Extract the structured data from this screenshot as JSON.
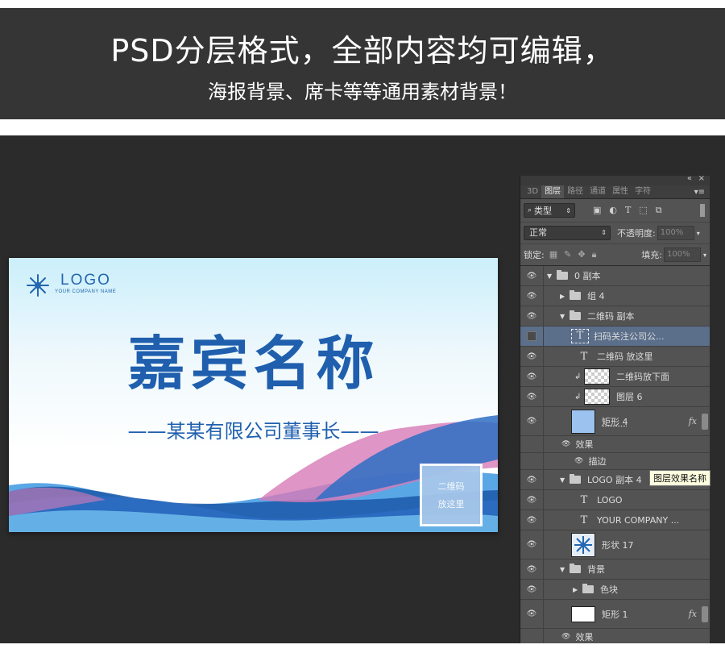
{
  "banner": {
    "headline": "PSD分层格式，全部内容均可编辑，",
    "subline": "海报背景、席卡等等通用素材背景！"
  },
  "card": {
    "logo_text": "LOGO",
    "logo_sub": "YOUR COMPANY NAME",
    "guest_name": "嘉宾名称",
    "title": "——某某有限公司董事长——",
    "qr_line1": "二维码",
    "qr_line2": "放这里",
    "colors": {
      "primary": "#1f5fae",
      "wave_blue": "#2b6bc0",
      "wave_pink": "#d77bb6"
    }
  },
  "panel": {
    "tabs": [
      "3D",
      "图层",
      "路径",
      "通道",
      "属性",
      "字符"
    ],
    "active_tab": "图层",
    "filter_label": "类型",
    "blend_mode": "正常",
    "opacity_label": "不透明度:",
    "opacity_value": "100%",
    "lock_label": "锁定:",
    "fill_label": "填充:",
    "fill_value": "100%",
    "tooltip": "图层效果名称",
    "layers": {
      "l0": "0 副本",
      "l1": "组 4",
      "l2": "二维码 副本",
      "l3": "扫码关注公司公...",
      "l4": "二维码 放这里",
      "l5": "二维码放下面",
      "l6": "图层 6",
      "l7": "矩形 4",
      "l7_effects": "效果",
      "l7_stroke": "描边",
      "l8": "LOGO 副本 4",
      "l9": "LOGO",
      "l10": "YOUR COMPANY ...",
      "l11": "形状 17",
      "l12": "背景",
      "l13": "色块",
      "l14": "矩形 1",
      "l14_effects": "效果"
    },
    "fx_label": "fx"
  }
}
